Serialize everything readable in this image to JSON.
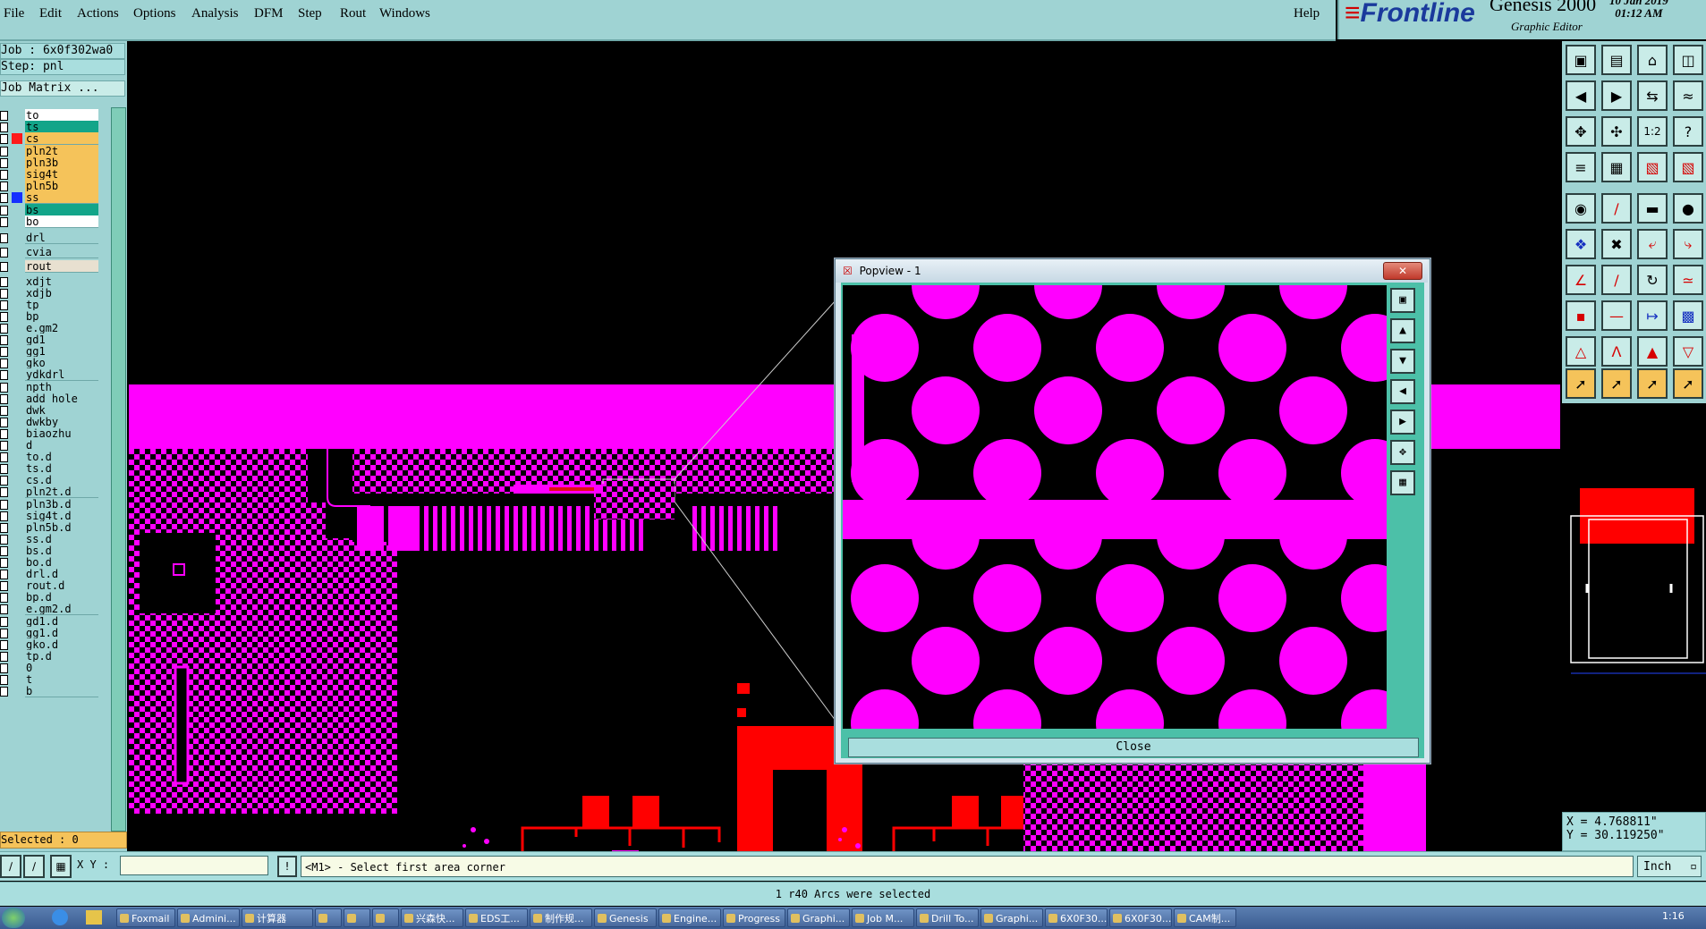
{
  "menubar": {
    "items": [
      "File",
      "Edit",
      "Actions",
      "Options",
      "Analysis",
      "DFM",
      "Step",
      "Rout",
      "Windows"
    ],
    "help": "Help"
  },
  "brand": {
    "logo": "Frontline",
    "product": "Genesis 2000",
    "subtitle": "Graphic Editor",
    "date": "10 Jan 2019",
    "time": "01:12 AM"
  },
  "job": {
    "job_label": "Job : 6x0f302wa0",
    "step_label": "Step: pnl",
    "matrix_label": "Job Matrix ..."
  },
  "layers": [
    {
      "name": "to",
      "color": "#ffffff"
    },
    {
      "name": "ts",
      "color": "#13a589"
    },
    {
      "name": "cs",
      "color": "#f5c35a",
      "active_color": "#ff1a1a"
    },
    {
      "name": "pln2t",
      "color": "#f5c35a"
    },
    {
      "name": "pln3b",
      "color": "#f5c35a"
    },
    {
      "name": "sig4t",
      "color": "#f5c35a"
    },
    {
      "name": "pln5b",
      "color": "#f5c35a"
    },
    {
      "name": "ss",
      "color": "#f5c35a",
      "active_color": "#1530ff"
    },
    {
      "name": "bs",
      "color": "#13a589"
    },
    {
      "name": "bo",
      "color": "#ffffff"
    },
    {
      "name": "drl",
      "color": "#9fd3d3"
    },
    {
      "name": "cvia",
      "color": "#9fd3d3"
    },
    {
      "name": "rout",
      "color": "#e8e0d0"
    },
    {
      "name": "xdjt",
      "color": "#9fd3d3"
    },
    {
      "name": "xdjb",
      "color": "#9fd3d3"
    },
    {
      "name": "tp",
      "color": "#9fd3d3"
    },
    {
      "name": "bp",
      "color": "#9fd3d3"
    },
    {
      "name": "e.gm2",
      "color": "#9fd3d3"
    },
    {
      "name": "gd1",
      "color": "#9fd3d3"
    },
    {
      "name": "gg1",
      "color": "#9fd3d3"
    },
    {
      "name": "gko",
      "color": "#9fd3d3"
    },
    {
      "name": "ydkdrl",
      "color": "#9fd3d3"
    },
    {
      "name": "npth",
      "color": "#9fd3d3"
    },
    {
      "name": "add_hole",
      "color": "#9fd3d3"
    },
    {
      "name": "dwk",
      "color": "#9fd3d3"
    },
    {
      "name": "dwkby",
      "color": "#9fd3d3"
    },
    {
      "name": "biaozhu",
      "color": "#9fd3d3"
    },
    {
      "name": "d",
      "color": "#9fd3d3"
    },
    {
      "name": "to.d",
      "color": "#9fd3d3"
    },
    {
      "name": "ts.d",
      "color": "#9fd3d3"
    },
    {
      "name": "cs.d",
      "color": "#9fd3d3"
    },
    {
      "name": "pln2t.d",
      "color": "#9fd3d3"
    },
    {
      "name": "pln3b.d",
      "color": "#9fd3d3"
    },
    {
      "name": "sig4t.d",
      "color": "#9fd3d3"
    },
    {
      "name": "pln5b.d",
      "color": "#9fd3d3"
    },
    {
      "name": "ss.d",
      "color": "#9fd3d3"
    },
    {
      "name": "bs.d",
      "color": "#9fd3d3"
    },
    {
      "name": "bo.d",
      "color": "#9fd3d3"
    },
    {
      "name": "drl.d",
      "color": "#9fd3d3"
    },
    {
      "name": "rout.d",
      "color": "#9fd3d3"
    },
    {
      "name": "bp.d",
      "color": "#9fd3d3"
    },
    {
      "name": "e.gm2.d",
      "color": "#9fd3d3"
    },
    {
      "name": "gd1.d",
      "color": "#9fd3d3"
    },
    {
      "name": "gg1.d",
      "color": "#9fd3d3"
    },
    {
      "name": "gko.d",
      "color": "#9fd3d3"
    },
    {
      "name": "tp.d",
      "color": "#9fd3d3"
    },
    {
      "name": "0",
      "color": "#9fd3d3"
    },
    {
      "name": "t",
      "color": "#9fd3d3"
    },
    {
      "name": "b",
      "color": "#9fd3d3"
    }
  ],
  "selected_label": "Selected : 0",
  "popview": {
    "title": "Popview - 1",
    "close_label": "Close"
  },
  "coords": {
    "x": "X = 4.768811\"",
    "y": "Y = 30.119250\""
  },
  "command": {
    "xy_label": "X Y :",
    "xy_value": "",
    "prompt": "<M1> - Select first area corner",
    "units": "Inch"
  },
  "message": "1 r40 Arcs were selected",
  "taskbar": {
    "tasks": [
      "Foxmail",
      "Admini...",
      "计算器",
      "",
      "",
      "",
      "兴森快...",
      "EDS工...",
      "制作规...",
      "Genesis",
      "Engine...",
      "Progress",
      "Graphi...",
      "Job M...",
      "Drill To...",
      "Graphi...",
      "6X0F30...",
      "6X0F30...",
      "CAM制..."
    ],
    "clock": "1:16"
  },
  "colors": {
    "panel": "#9fd3d3",
    "magenta": "#ff00ff",
    "red": "#ff0000",
    "highlight": "#f5c35a"
  }
}
